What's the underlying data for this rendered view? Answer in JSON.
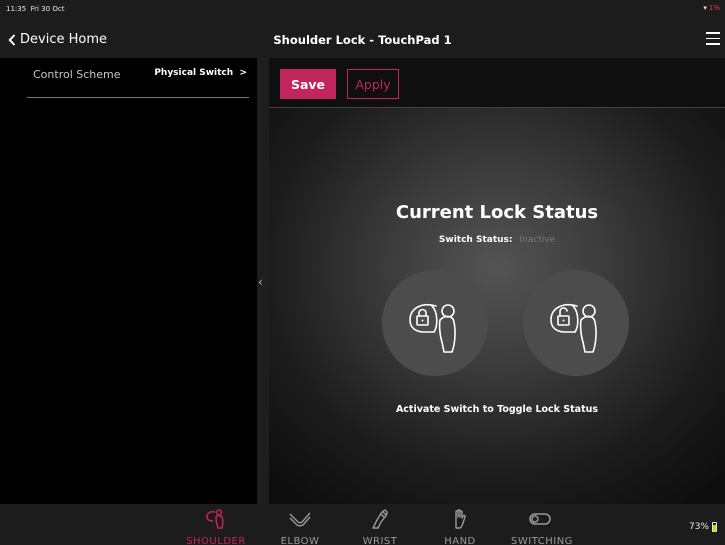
{
  "status_bar": {
    "time": "11:35",
    "date": "Fri 30 Oct",
    "battery_small": "1%"
  },
  "nav": {
    "back_label": "Device Home",
    "title": "Shoulder Lock - TouchPad 1"
  },
  "sidebar": {
    "items": [
      {
        "label": "Control Scheme",
        "value": "Physical Switch"
      }
    ]
  },
  "toolbar": {
    "save_label": "Save",
    "apply_label": "Apply"
  },
  "main": {
    "title": "Current Lock Status",
    "switch_status_label": "Switch Status:",
    "switch_status_value": "Inactive",
    "hint": "Activate Switch to Toggle Lock Status"
  },
  "tabs": [
    {
      "label": "SHOULDER",
      "icon": "shoulder-icon",
      "active": true
    },
    {
      "label": "ELBOW",
      "icon": "elbow-icon",
      "active": false
    },
    {
      "label": "WRIST",
      "icon": "wrist-icon",
      "active": false
    },
    {
      "label": "HAND",
      "icon": "hand-icon",
      "active": false
    },
    {
      "label": "SWITCHING",
      "icon": "toggle-icon",
      "active": false
    }
  ],
  "battery": {
    "percent": "73%"
  },
  "colors": {
    "accent": "#c2255c",
    "inactive_text": "#7a7a7a",
    "battery_fill": "#c5d600"
  }
}
